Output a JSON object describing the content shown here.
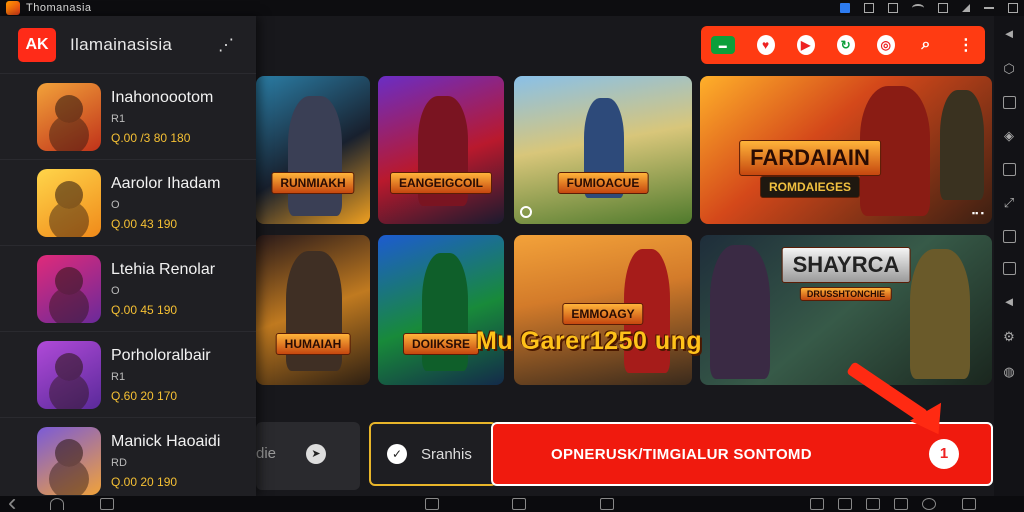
{
  "status": {
    "title": "Thomanasia"
  },
  "drawer": {
    "brand_logo": "AK",
    "brand_name": "Ilamainasisia",
    "items": [
      {
        "title": "Inahonoootom",
        "sub": "R1",
        "meta": "Q.00 /3 80 180"
      },
      {
        "title": "Aarolor Ihadam",
        "sub": "O",
        "meta": "Q.00 43 190"
      },
      {
        "title": "Ltehia Renolar",
        "sub": "O",
        "meta": "Q.00 45 190"
      },
      {
        "title": "Porholoralbair",
        "sub": "R1",
        "meta": "Q.60 20 170"
      },
      {
        "title": "Manick Haoaidi",
        "sub": "RD",
        "meta": "Q.00 20 190"
      }
    ]
  },
  "tiles": [
    {
      "label": "RUNMIAKH",
      "sub": ""
    },
    {
      "label": "EANGEIGCOIL",
      "sub": ""
    },
    {
      "label": "FUMIOACUE",
      "sub": ""
    },
    {
      "label": "FARDAIAIN",
      "sub": ""
    },
    {
      "label": "HUMAIAH",
      "sub": ""
    },
    {
      "label": "DOIIKSRE",
      "sub": ""
    },
    {
      "label": "EMMOAGY",
      "sub": ""
    },
    {
      "label": "SHAYRCA",
      "sub": ""
    }
  ],
  "banner": {
    "title": "FARDAIAIN",
    "subtitle": "ROMDAIEGES",
    "banner2": "SHAYRCA",
    "banner2_sub": "DRUSSHTONCHIE"
  },
  "overlay_caption": "Mu Garer1250 ung",
  "mini": {
    "text": "die"
  },
  "search": {
    "text": "Sranhis"
  },
  "cta": {
    "label": "OPNERUSK/TIMGIALUR SONTOMD",
    "badge": "1"
  },
  "icons": [
    "share-icon",
    "check-icon",
    "play-icon",
    "search-icon",
    "more-icon"
  ],
  "colors": {
    "accent": "#ff3b12",
    "cta": "#f01a0e",
    "gold": "#f5c034"
  }
}
